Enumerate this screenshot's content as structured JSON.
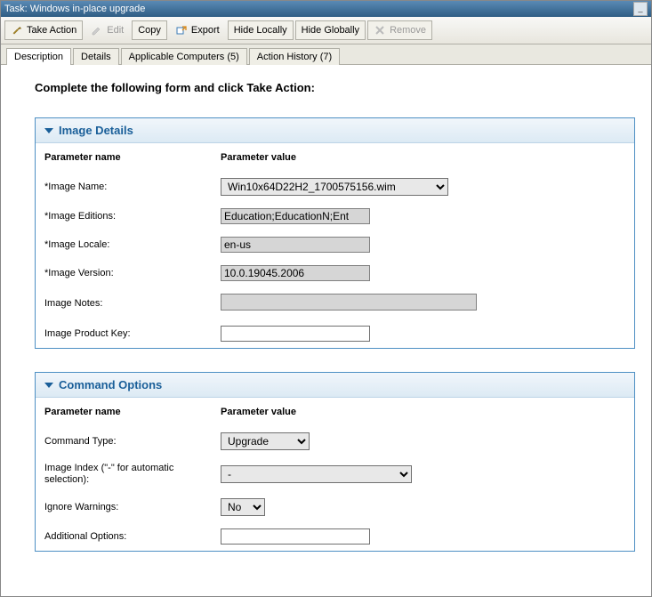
{
  "window": {
    "title": "Task: Windows in-place upgrade"
  },
  "toolbar": {
    "take_action": "Take Action",
    "edit": "Edit",
    "copy": "Copy",
    "export": "Export",
    "hide_locally": "Hide Locally",
    "hide_globally": "Hide Globally",
    "remove": "Remove"
  },
  "tabs": {
    "description": "Description",
    "details": "Details",
    "applicable": "Applicable Computers (5)",
    "history": "Action History (7)"
  },
  "instruction": "Complete the following form and click Take Action:",
  "section1": {
    "title": "Image Details"
  },
  "section2": {
    "title": "Command Options"
  },
  "col_headers": {
    "name": "Parameter name",
    "value": "Parameter value"
  },
  "image_details": {
    "name_label": "*Image Name:",
    "name_value": "Win10x64D22H2_1700575156.wim",
    "editions_label": "*Image Editions:",
    "editions_value": "Education;EducationN;Ent",
    "locale_label": "*Image Locale:",
    "locale_value": "en-us",
    "version_label": "*Image Version:",
    "version_value": "10.0.19045.2006",
    "notes_label": "Image Notes:",
    "notes_value": "",
    "key_label": "Image Product Key:",
    "key_value": ""
  },
  "command_options": {
    "type_label": "Command Type:",
    "type_value": "Upgrade",
    "index_label": "Image Index (\"-\" for automatic selection):",
    "index_value": "-",
    "warnings_label": "Ignore Warnings:",
    "warnings_value": "No",
    "additional_label": "Additional Options:",
    "additional_value": ""
  }
}
